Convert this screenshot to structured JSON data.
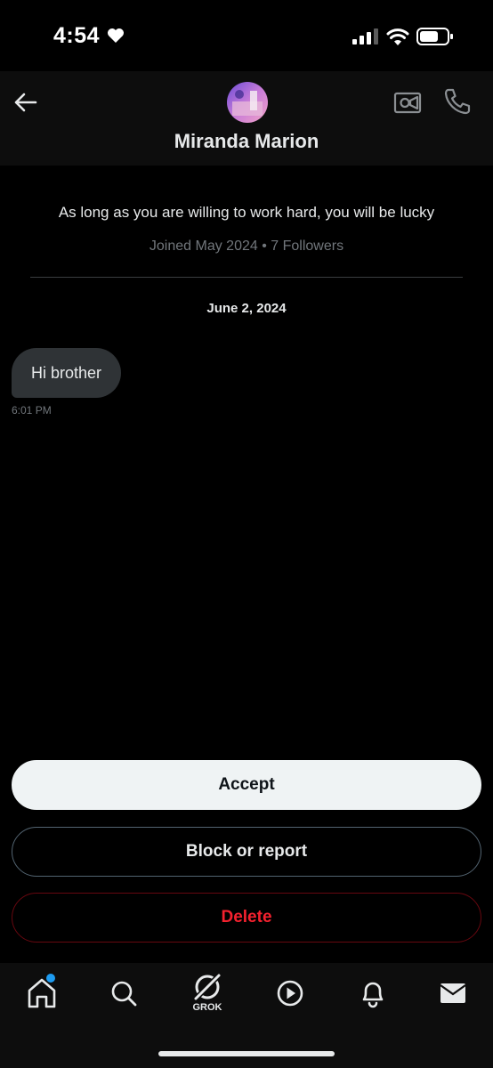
{
  "status_bar": {
    "time": "4:54"
  },
  "header": {
    "name": "Miranda Marion"
  },
  "profile": {
    "bio": "As long as you are willing to work hard, you will be lucky",
    "joined": "Joined May 2024",
    "separator": " • ",
    "followers": "7 Followers"
  },
  "conversation": {
    "date": "June 2, 2024",
    "messages": [
      {
        "text": "Hi brother",
        "time": "6:01 PM"
      }
    ]
  },
  "actions": {
    "accept": "Accept",
    "block": "Block or report",
    "delete": "Delete"
  },
  "tabbar": {
    "grok_label": "GROK"
  },
  "icons": [
    "heart-icon",
    "signal-icon",
    "wifi-icon",
    "battery-icon",
    "back-arrow-icon",
    "video-camera-icon",
    "phone-icon",
    "home-icon",
    "search-icon",
    "grok-icon",
    "video-play-icon",
    "bell-icon",
    "mail-icon"
  ],
  "colors": {
    "accent": "#1d9bf0",
    "delete": "#f4212e",
    "bubble": "#2f3336",
    "accept_bg": "#eff3f4"
  }
}
